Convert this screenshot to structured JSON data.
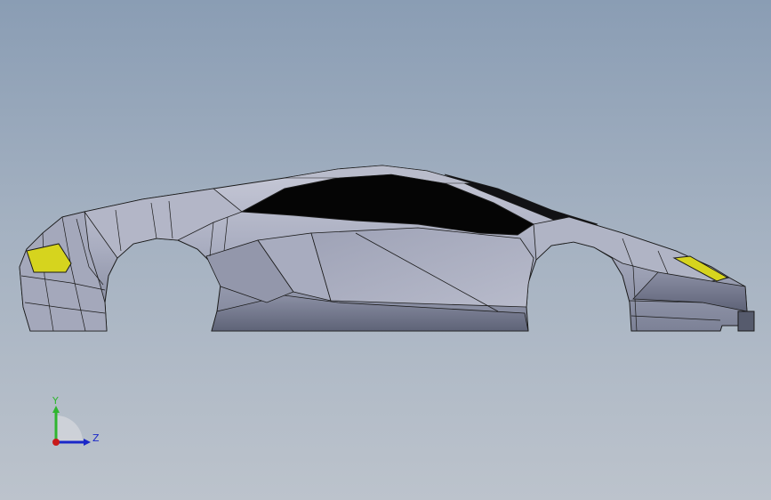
{
  "viewport": {
    "background_top": "#8a9db4",
    "background_bottom": "#bcc3cc"
  },
  "model": {
    "name": "sports-car-body",
    "colors": {
      "body": "#a7abbf",
      "body_light": "#c3c6d4",
      "body_dark": "#6f7488",
      "glass": "#050505",
      "headlight": "#d6d41e",
      "edge": "#1a1a1a"
    }
  },
  "triad": {
    "y_label": "Y",
    "z_label": "Z",
    "y_color": "#2fb52f",
    "z_color": "#1a27c8",
    "origin_color": "#c81a1a"
  }
}
